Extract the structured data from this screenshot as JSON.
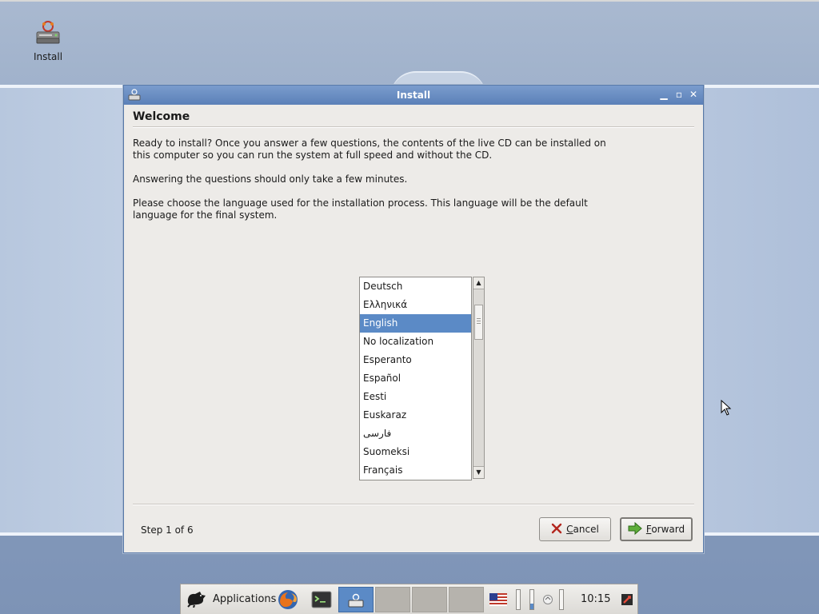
{
  "desktop": {
    "icon": {
      "label": "Install",
      "icon": "installer-drive-icon"
    }
  },
  "window": {
    "title": "Install",
    "title_icon": "installer-icon",
    "controls": {
      "minimize": "minimize-icon",
      "maximize": "maximize-icon",
      "close": "close-icon"
    },
    "heading": "Welcome",
    "paragraphs": [
      "Ready to install? Once you answer a few questions, the contents of the live CD can be installed on this computer so you can run the system at full speed and without the CD.",
      "Answering the questions should only take a few minutes.",
      "Please choose the language used for the installation process. This language will be the default language for the final system."
    ],
    "languages": [
      "Deutsch",
      "Ελληνικά",
      "English",
      "No localization",
      "Esperanto",
      "Español",
      "Eesti",
      "Euskaraz",
      "فارسی",
      "Suomeksi",
      "Français"
    ],
    "selected_language": "English",
    "step_text": "Step 1 of 6",
    "buttons": {
      "cancel": {
        "mnemonic": "C",
        "rest": "ancel",
        "icon": "cancel-x-icon"
      },
      "forward": {
        "mnemonic": "F",
        "rest": "orward",
        "icon": "forward-arrow-icon"
      }
    }
  },
  "taskbar": {
    "applications_label": "Applications",
    "applications_icon": "xfce-mouse-icon",
    "launchers": [
      "firefox-icon",
      "terminal-icon"
    ],
    "active_task_icon": "installer-icon",
    "tray_icons": [
      "us-flag-keyboard-layout-icon",
      "network-icon",
      "logout-icon"
    ],
    "clock": "10:15"
  },
  "colors": {
    "titlebar": "#5b80b8",
    "selection": "#5b8ac6",
    "window_bg": "#edebe8"
  }
}
